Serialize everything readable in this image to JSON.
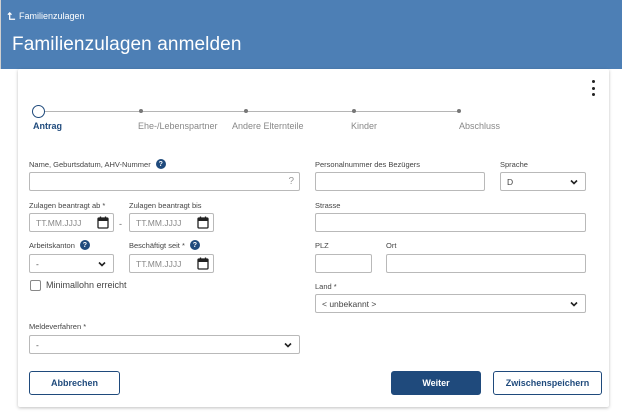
{
  "header": {
    "back_label": "Familienzulagen",
    "title": "Familienzulagen anmelden"
  },
  "stepper": {
    "steps": [
      {
        "label": "Antrag",
        "active": true
      },
      {
        "label": "Ehe-/Lebenspartner",
        "active": false
      },
      {
        "label": "Andere Elternteile",
        "active": false
      },
      {
        "label": "Kinder",
        "active": false
      },
      {
        "label": "Abschluss",
        "active": false
      }
    ]
  },
  "form": {
    "name_label": "Name, Geburtsdatum, AHV-Nummer",
    "name_value": "",
    "name_suffix": "?",
    "personal_label": "Personalnummer des Bezügers",
    "sprache_label": "Sprache",
    "sprache_value": "D",
    "zulagen_ab_label": "Zulagen beantragt ab *",
    "zulagen_bis_label": "Zulagen beantragt bis",
    "date_placeholder": "TT.MM.JJJJ",
    "date_separator": "-",
    "strasse_label": "Strasse",
    "arbeitskanton_label": "Arbeitskanton",
    "arbeitskanton_value": "-",
    "beschaeftigt_label": "Beschäftigt seit *",
    "plz_label": "PLZ",
    "ort_label": "Ort",
    "minimallohn_label": "Minimallohn erreicht",
    "land_label": "Land *",
    "land_value": "< unbekannt >",
    "meldeverfahren_label": "Meldeverfahren *",
    "meldeverfahren_value": "-",
    "help_glyph": "?"
  },
  "actions": {
    "cancel_label": "Abbrechen",
    "next_label": "Weiter",
    "save_label": "Zwischenspeichern"
  },
  "colors": {
    "header_bg": "#4d7fb5",
    "primary": "#1f4a7c"
  }
}
